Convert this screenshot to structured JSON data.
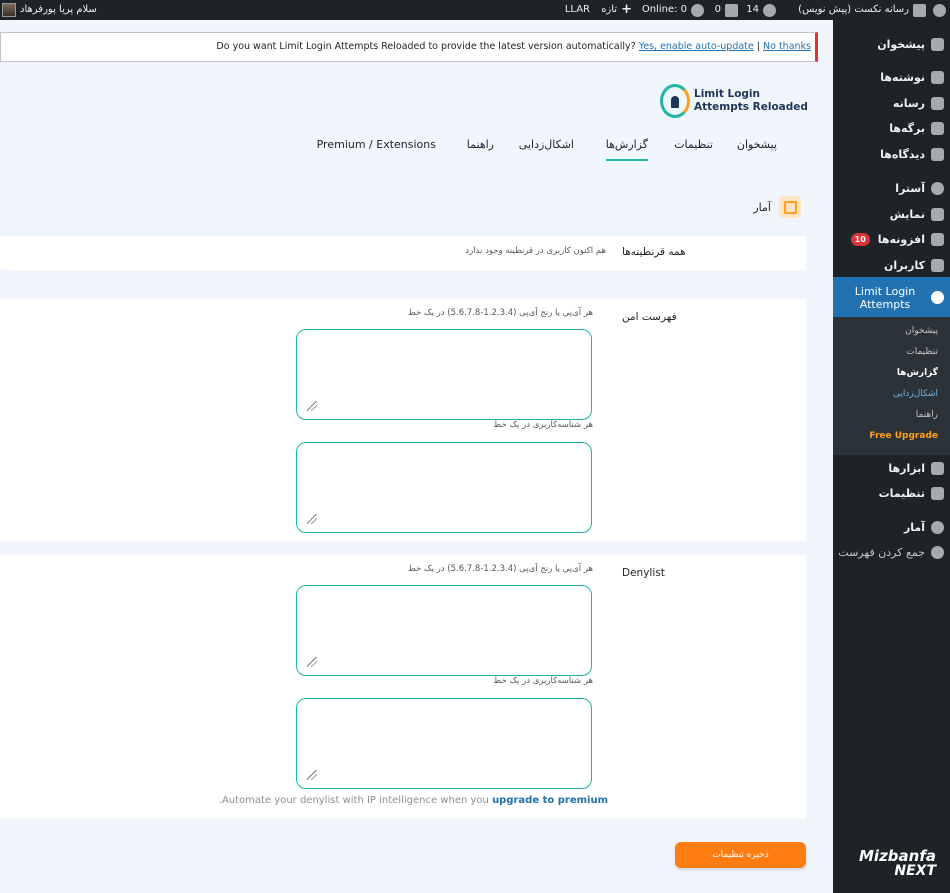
{
  "adminbar": {
    "site_name": "رسانه نکست (پیش نویس)",
    "updates_count": "14",
    "comments_count": "0",
    "online_label": "Online: 0",
    "new_label": "تازه",
    "llar_label": "LLAR",
    "greeting": "سلام پریا پورفرهاد"
  },
  "sidebar": {
    "items": [
      {
        "label": "پیشخوان",
        "icon": "dashboard-icon"
      },
      {
        "label": "نوشته‌ها",
        "icon": "pin-icon"
      },
      {
        "label": "رسانه",
        "icon": "media-icon"
      },
      {
        "label": "برگه‌ها",
        "icon": "pages-icon"
      },
      {
        "label": "دیدگاه‌ها",
        "icon": "comments-icon"
      },
      {
        "label": "آسترا",
        "icon": "astra-icon"
      },
      {
        "label": "نمایش",
        "icon": "appearance-icon"
      },
      {
        "label": "افزونه‌ها",
        "icon": "plugins-icon",
        "badge": "10"
      },
      {
        "label": "کاربران",
        "icon": "users-icon"
      },
      {
        "label": "Limit Login Attempts",
        "icon": "llar-icon"
      },
      {
        "label": "ابزارها",
        "icon": "tools-icon"
      },
      {
        "label": "تنظیمات",
        "icon": "settings-icon"
      },
      {
        "label": "آمار",
        "icon": "stats-icon"
      },
      {
        "label": "جمع کردن فهرست",
        "icon": "collapse-icon"
      }
    ],
    "submenu": [
      "پیشخوان",
      "تنظیمات",
      "گزارش‌ها",
      "اشکال‌زدایی",
      "راهنما",
      "Free Upgrade"
    ],
    "brand_line1": "Mizbanfa",
    "brand_line2": "NEXT"
  },
  "notice": {
    "text": "Do you want Limit Login Attempts Reloaded to provide the latest version automatically?",
    "enable_link": "Yes, enable auto-update",
    "separator": "|",
    "dismiss_link": "No thanks"
  },
  "plugin": {
    "logo_line1": "Limit Login",
    "logo_line2": "Attempts Reloaded"
  },
  "tabs": [
    "پیشخوان",
    "تنظیمات",
    "گزارش‌ها",
    "اشکال‌زدایی",
    "راهنما",
    "Premium / Extensions"
  ],
  "stats_title": "آمار",
  "sections": {
    "all_zones": {
      "label": "همه قرنطینه‌ها",
      "text": "هم اکنون کاربری در قرنطینه وجود ندارد"
    },
    "safelist": {
      "label": "فهرست امن",
      "ip_hint": "هر آی‌پی یا رنج آی‌پی (1.2.3.4-5.6.7.8) در یک خط",
      "user_hint": "هر شناسه‌کاربری در یک خط"
    },
    "denylist": {
      "label": "Denylist",
      "ip_hint": "هر آی‌پی یا رنج آی‌پی (1.2.3.4-5.6.7.8) در یک خط",
      "user_hint": "هر شناسه‌کاربری در یک خط",
      "promo_text": "Automate your denylist with IP intelligence when you",
      "promo_link": "upgrade to premium",
      "promo_end": "."
    }
  },
  "save_label": "ذخیره تنظیمات",
  "colors": {
    "accent": "#1fb7a4",
    "orange": "#ff7c12",
    "wp_blue": "#2271b1",
    "admin_dark": "#1d2327"
  }
}
